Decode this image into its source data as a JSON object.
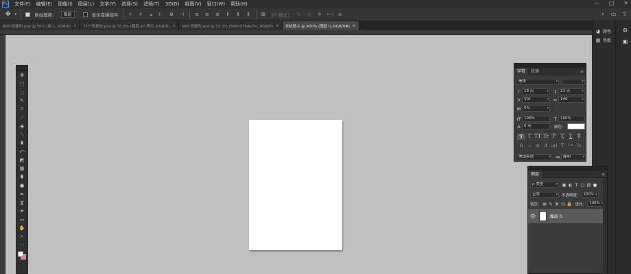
{
  "menubar": {
    "logo": "Ps",
    "items": [
      "文件(F)",
      "编辑(E)",
      "图像(I)",
      "图层(L)",
      "文字(Y)",
      "选择(S)",
      "滤镜(T)",
      "3D(D)",
      "视图(V)",
      "窗口(W)",
      "帮助(H)"
    ],
    "window_controls": [
      "—",
      "□",
      "✕"
    ]
  },
  "options": {
    "auto_select_label": "自动选择：",
    "auto_select_checked": true,
    "auto_select_value": "图层",
    "transform_label": "显示变换控件",
    "transform_checked": false,
    "mode_3d_label": "3D 模式："
  },
  "tabs": [
    {
      "label": "666-恢复的.psd @ 50% (组 1, RGB/8)",
      "active": false
    },
    {
      "label": "777-恢复的.psd @ 33.3% (图层 47 拷贝, RGB/8)",
      "active": false
    },
    {
      "label": "668-恢复的.psd @ 33.3% (5b0c0764e2fc, RGB/8)",
      "active": false
    },
    {
      "label": "未标题-1 @ 400% (图层 0, RGB/8#)",
      "active": true
    }
  ],
  "tab_close": "×",
  "right_strip": {
    "items": [
      {
        "icon": "color-icon",
        "label": "颜色"
      },
      {
        "icon": "swatches-icon",
        "label": "色板"
      }
    ]
  },
  "character": {
    "tabs": [
      "字符",
      "段落"
    ],
    "font_family": "黑体",
    "font_style": "-",
    "font_size": "18 点",
    "leading": "21 点",
    "kerning": "V/A",
    "tracking": "140",
    "vscale_pct": "0%",
    "vertical_scale": "100%",
    "horizontal_scale": "100%",
    "baseline_shift": "0 点",
    "color_label": "颜色：",
    "color_value": "#ffffff",
    "glyphs_row1": [
      "T",
      "T",
      "TT",
      "Tr",
      "T¹",
      "T,",
      "T",
      "Ŧ"
    ],
    "glyphs_row2": [
      "fi",
      "ℴ",
      "st",
      "A",
      "ad",
      "T",
      "1st",
      "½"
    ],
    "language": "美国英语",
    "antialias_icon": "aa",
    "antialias": "犀利"
  },
  "layers": {
    "tab": "图层",
    "filter_label": "ρ 类型",
    "blend_mode": "正常",
    "opacity_label": "不透明度：",
    "opacity_value": "100%",
    "lock_label": "锁定：",
    "fill_label": "填充：",
    "fill_value": "100%",
    "items": [
      {
        "name": "图层 0",
        "visible": true,
        "selected": true
      }
    ]
  }
}
